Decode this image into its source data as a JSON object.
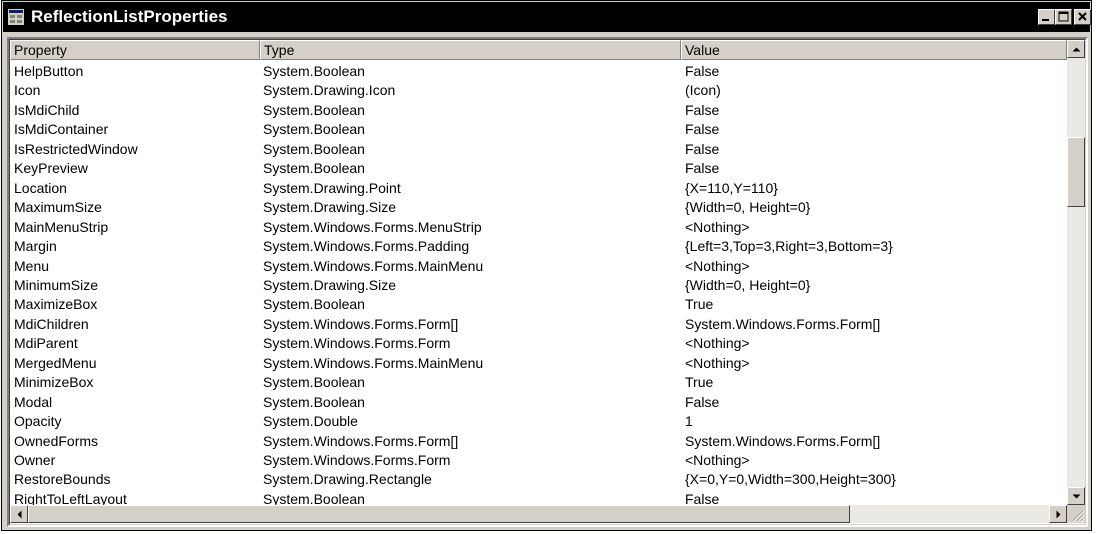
{
  "window": {
    "title": "ReflectionListProperties",
    "minimize_icon": "minimize-icon",
    "maximize_icon": "maximize-icon",
    "close_icon": "close-icon"
  },
  "list": {
    "columns": [
      "Property",
      "Type",
      "Value"
    ],
    "rows": [
      [
        "HelpButton",
        "System.Boolean",
        "False"
      ],
      [
        "Icon",
        "System.Drawing.Icon",
        "(Icon)"
      ],
      [
        "IsMdiChild",
        "System.Boolean",
        "False"
      ],
      [
        "IsMdiContainer",
        "System.Boolean",
        "False"
      ],
      [
        "IsRestrictedWindow",
        "System.Boolean",
        "False"
      ],
      [
        "KeyPreview",
        "System.Boolean",
        "False"
      ],
      [
        "Location",
        "System.Drawing.Point",
        "{X=110,Y=110}"
      ],
      [
        "MaximumSize",
        "System.Drawing.Size",
        "{Width=0, Height=0}"
      ],
      [
        "MainMenuStrip",
        "System.Windows.Forms.MenuStrip",
        "<Nothing>"
      ],
      [
        "Margin",
        "System.Windows.Forms.Padding",
        "{Left=3,Top=3,Right=3,Bottom=3}"
      ],
      [
        "Menu",
        "System.Windows.Forms.MainMenu",
        "<Nothing>"
      ],
      [
        "MinimumSize",
        "System.Drawing.Size",
        "{Width=0, Height=0}"
      ],
      [
        "MaximizeBox",
        "System.Boolean",
        "True"
      ],
      [
        "MdiChildren",
        "System.Windows.Forms.Form[]",
        "System.Windows.Forms.Form[]"
      ],
      [
        "MdiParent",
        "System.Windows.Forms.Form",
        "<Nothing>"
      ],
      [
        "MergedMenu",
        "System.Windows.Forms.MainMenu",
        "<Nothing>"
      ],
      [
        "MinimizeBox",
        "System.Boolean",
        "True"
      ],
      [
        "Modal",
        "System.Boolean",
        "False"
      ],
      [
        "Opacity",
        "System.Double",
        "1"
      ],
      [
        "OwnedForms",
        "System.Windows.Forms.Form[]",
        "System.Windows.Forms.Form[]"
      ],
      [
        "Owner",
        "System.Windows.Forms.Form",
        "<Nothing>"
      ],
      [
        "RestoreBounds",
        "System.Drawing.Rectangle",
        "{X=0,Y=0,Width=300,Height=300}"
      ],
      [
        "RightToLeftLayout",
        "System.Boolean",
        "False"
      ]
    ]
  },
  "scrollbars": {
    "vertical_position": 0.22,
    "horizontal_position": 0.0
  }
}
